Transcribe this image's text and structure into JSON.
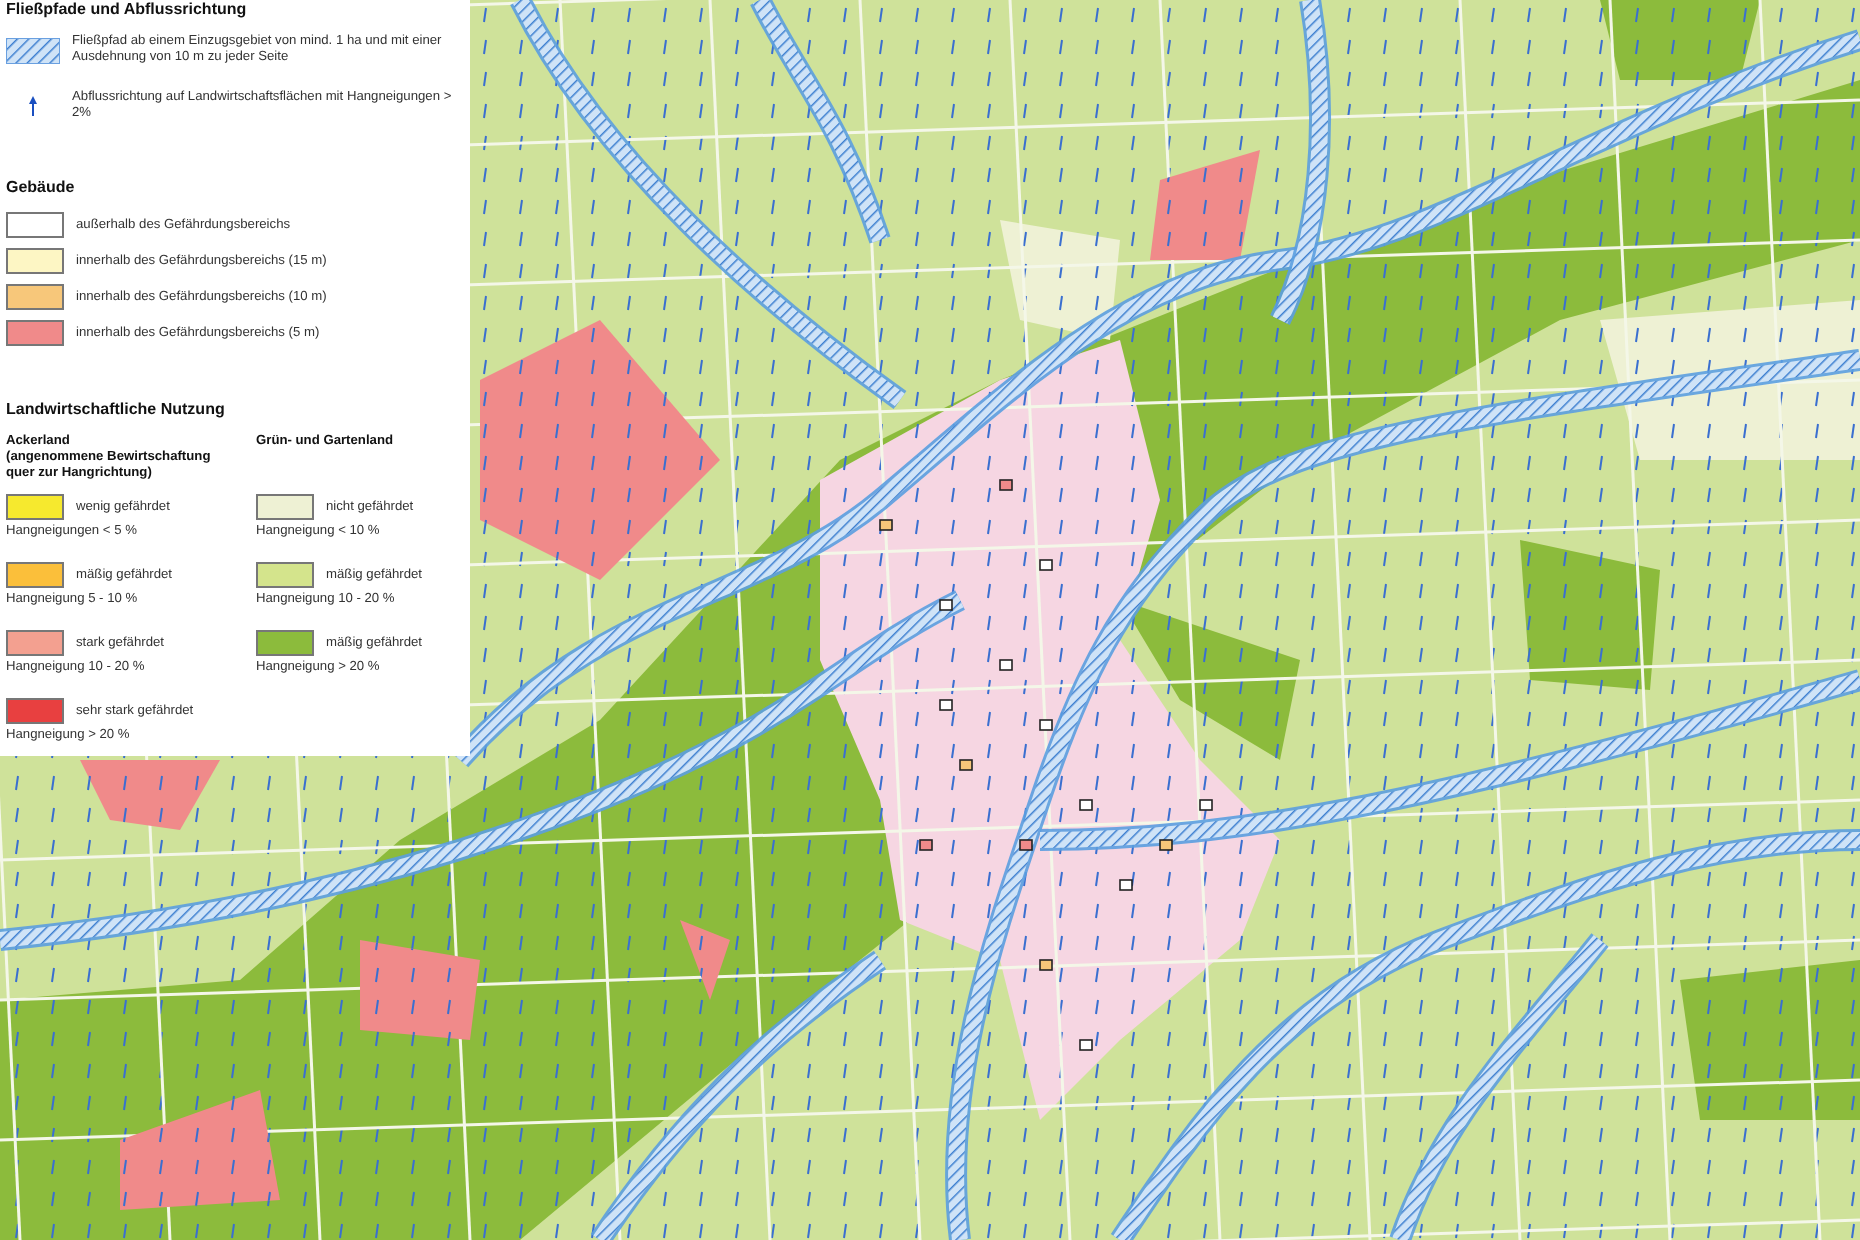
{
  "legend": {
    "flow_section": {
      "title": "Fließpfade und Abflussrichtung",
      "items": [
        {
          "kind": "hatch",
          "label": "Fließpfad ab einem Einzugsgebiet von mind. 1 ha und mit einer Ausdehnung von 10 m zu jeder Seite"
        },
        {
          "kind": "arrow",
          "label": "Abflussrichtung auf Landwirtschaftsflächen mit Hangneigungen > 2%"
        }
      ]
    },
    "buildings": {
      "title": "Gebäude",
      "items": [
        {
          "label": "außerhalb des Gefährdungsbereichs",
          "color": "#ffffff"
        },
        {
          "label": "innerhalb des Gefährdungsbereichs (15 m)",
          "color": "#fdf6c4"
        },
        {
          "label": "innerhalb des Gefährdungsbereichs (10 m)",
          "color": "#f7c77a"
        },
        {
          "label": "innerhalb des Gefährdungsbereichs (5 m)",
          "color": "#f08a8a"
        }
      ]
    },
    "land_use": {
      "title": "Landwirtschaftliche Nutzung",
      "columns": [
        {
          "heading": "Ackerland\n(angenommene Bewirtschaftung\nquer zur Hangrichtung)",
          "items": [
            {
              "label": "wenig gefährdet",
              "note": "Hangneigungen < 5 %",
              "color": "#f6e92e"
            },
            {
              "label": "mäßig gefährdet",
              "note": "Hangneigung 5 - 10 %",
              "color": "#fbbf3a"
            },
            {
              "label": "stark gefährdet",
              "note": "Hangneigung 10 - 20 %",
              "color": "#f3a090"
            },
            {
              "label": "sehr stark gefährdet",
              "note": "Hangneigung > 20 %",
              "color": "#e84040"
            }
          ]
        },
        {
          "heading": "Grün- und Gartenland",
          "items": [
            {
              "label": "nicht gefährdet",
              "note": "Hangneigung < 10 %",
              "color": "#eef1d4"
            },
            {
              "label": "mäßig gefährdet",
              "note": "Hangneigung 10 - 20 %",
              "color": "#d4e48c"
            },
            {
              "label": "mäßig gefährdet",
              "note": "Hangneigung > 20 %",
              "color": "#8cbb3c"
            }
          ]
        }
      ]
    }
  }
}
